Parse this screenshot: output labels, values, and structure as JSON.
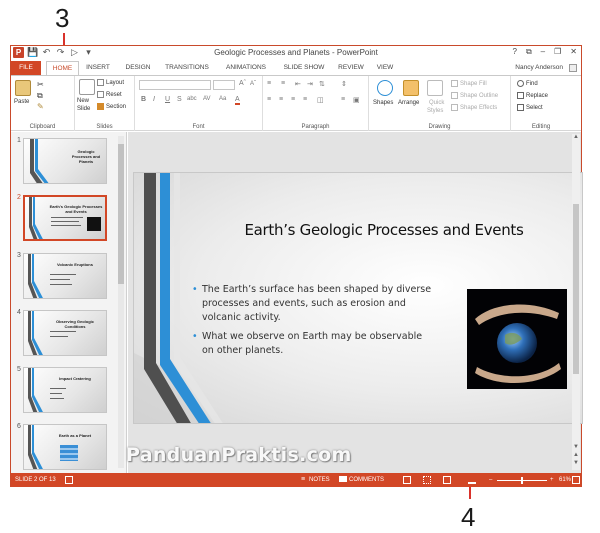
{
  "callouts": {
    "top": "3",
    "bottom": "4"
  },
  "window": {
    "title": "Geologic Processes and Planets - PowerPoint",
    "app_icon": "P",
    "controls": {
      "help": "?",
      "ribbon_options": "⧉",
      "minimize": "–",
      "restore": "❐",
      "close": "✕"
    }
  },
  "quick_access": [
    "save-icon",
    "undo-icon",
    "redo-icon",
    "start-from-beginning-icon"
  ],
  "tabs": [
    "FILE",
    "HOME",
    "INSERT",
    "DESIGN",
    "TRANSITIONS",
    "ANIMATIONS",
    "SLIDE SHOW",
    "REVIEW",
    "VIEW"
  ],
  "active_tab": "HOME",
  "user": {
    "name": "Nancy Anderson"
  },
  "ribbon": {
    "clipboard": {
      "label": "Clipboard",
      "paste": "Paste"
    },
    "slides": {
      "label": "Slides",
      "new_slide_1": "New",
      "new_slide_2": "Slide",
      "layout": "Layout",
      "reset": "Reset",
      "section": "Section"
    },
    "font": {
      "label": "Font",
      "bold": "B",
      "italic": "I",
      "underline": "U",
      "strike": "S",
      "spacing": "abc",
      "av": "AV",
      "case": "Aa",
      "color": "A"
    },
    "paragraph": {
      "label": "Paragraph"
    },
    "drawing": {
      "label": "Drawing",
      "shapes": "Shapes",
      "arrange": "Arrange",
      "quick_styles_1": "Quick",
      "quick_styles_2": "Styles",
      "shape_fill": "Shape Fill",
      "shape_outline": "Shape Outline",
      "shape_effects": "Shape Effects"
    },
    "editing": {
      "label": "Editing",
      "find": "Find",
      "replace": "Replace",
      "select": "Select"
    }
  },
  "thumbnails": [
    {
      "num": "1",
      "title": "Geologic Processes and Planets",
      "selected": false
    },
    {
      "num": "2",
      "title": "Earth's Geologic Processes and Events",
      "selected": true
    },
    {
      "num": "3",
      "title": "Volcanic Eruptions",
      "selected": false
    },
    {
      "num": "4",
      "title": "Observing Geologic Conditions",
      "selected": false
    },
    {
      "num": "5",
      "title": "Impact Cratering",
      "selected": false
    },
    {
      "num": "6",
      "title": "Earth as a Planet",
      "selected": false
    }
  ],
  "slide": {
    "title": "Earth’s Geologic Processes and Events",
    "bullets": [
      "The Earth’s surface has been shaped by diverse processes and events, such as erosion and volcanic activity.",
      "What we observe on Earth may be observable on other planets."
    ]
  },
  "watermark": "PanduanPraktis.com",
  "status": {
    "slide_counter": "SLIDE 2 OF 13",
    "notes": "NOTES",
    "comments": "COMMENTS",
    "zoom_minus": "–",
    "zoom_plus": "+",
    "zoom": "61%",
    "zoom_fraction": 0.61
  },
  "colors": {
    "accent": "#d24726",
    "bullet": "#2d8fd6",
    "ribbon_bg": "#ffffff"
  }
}
